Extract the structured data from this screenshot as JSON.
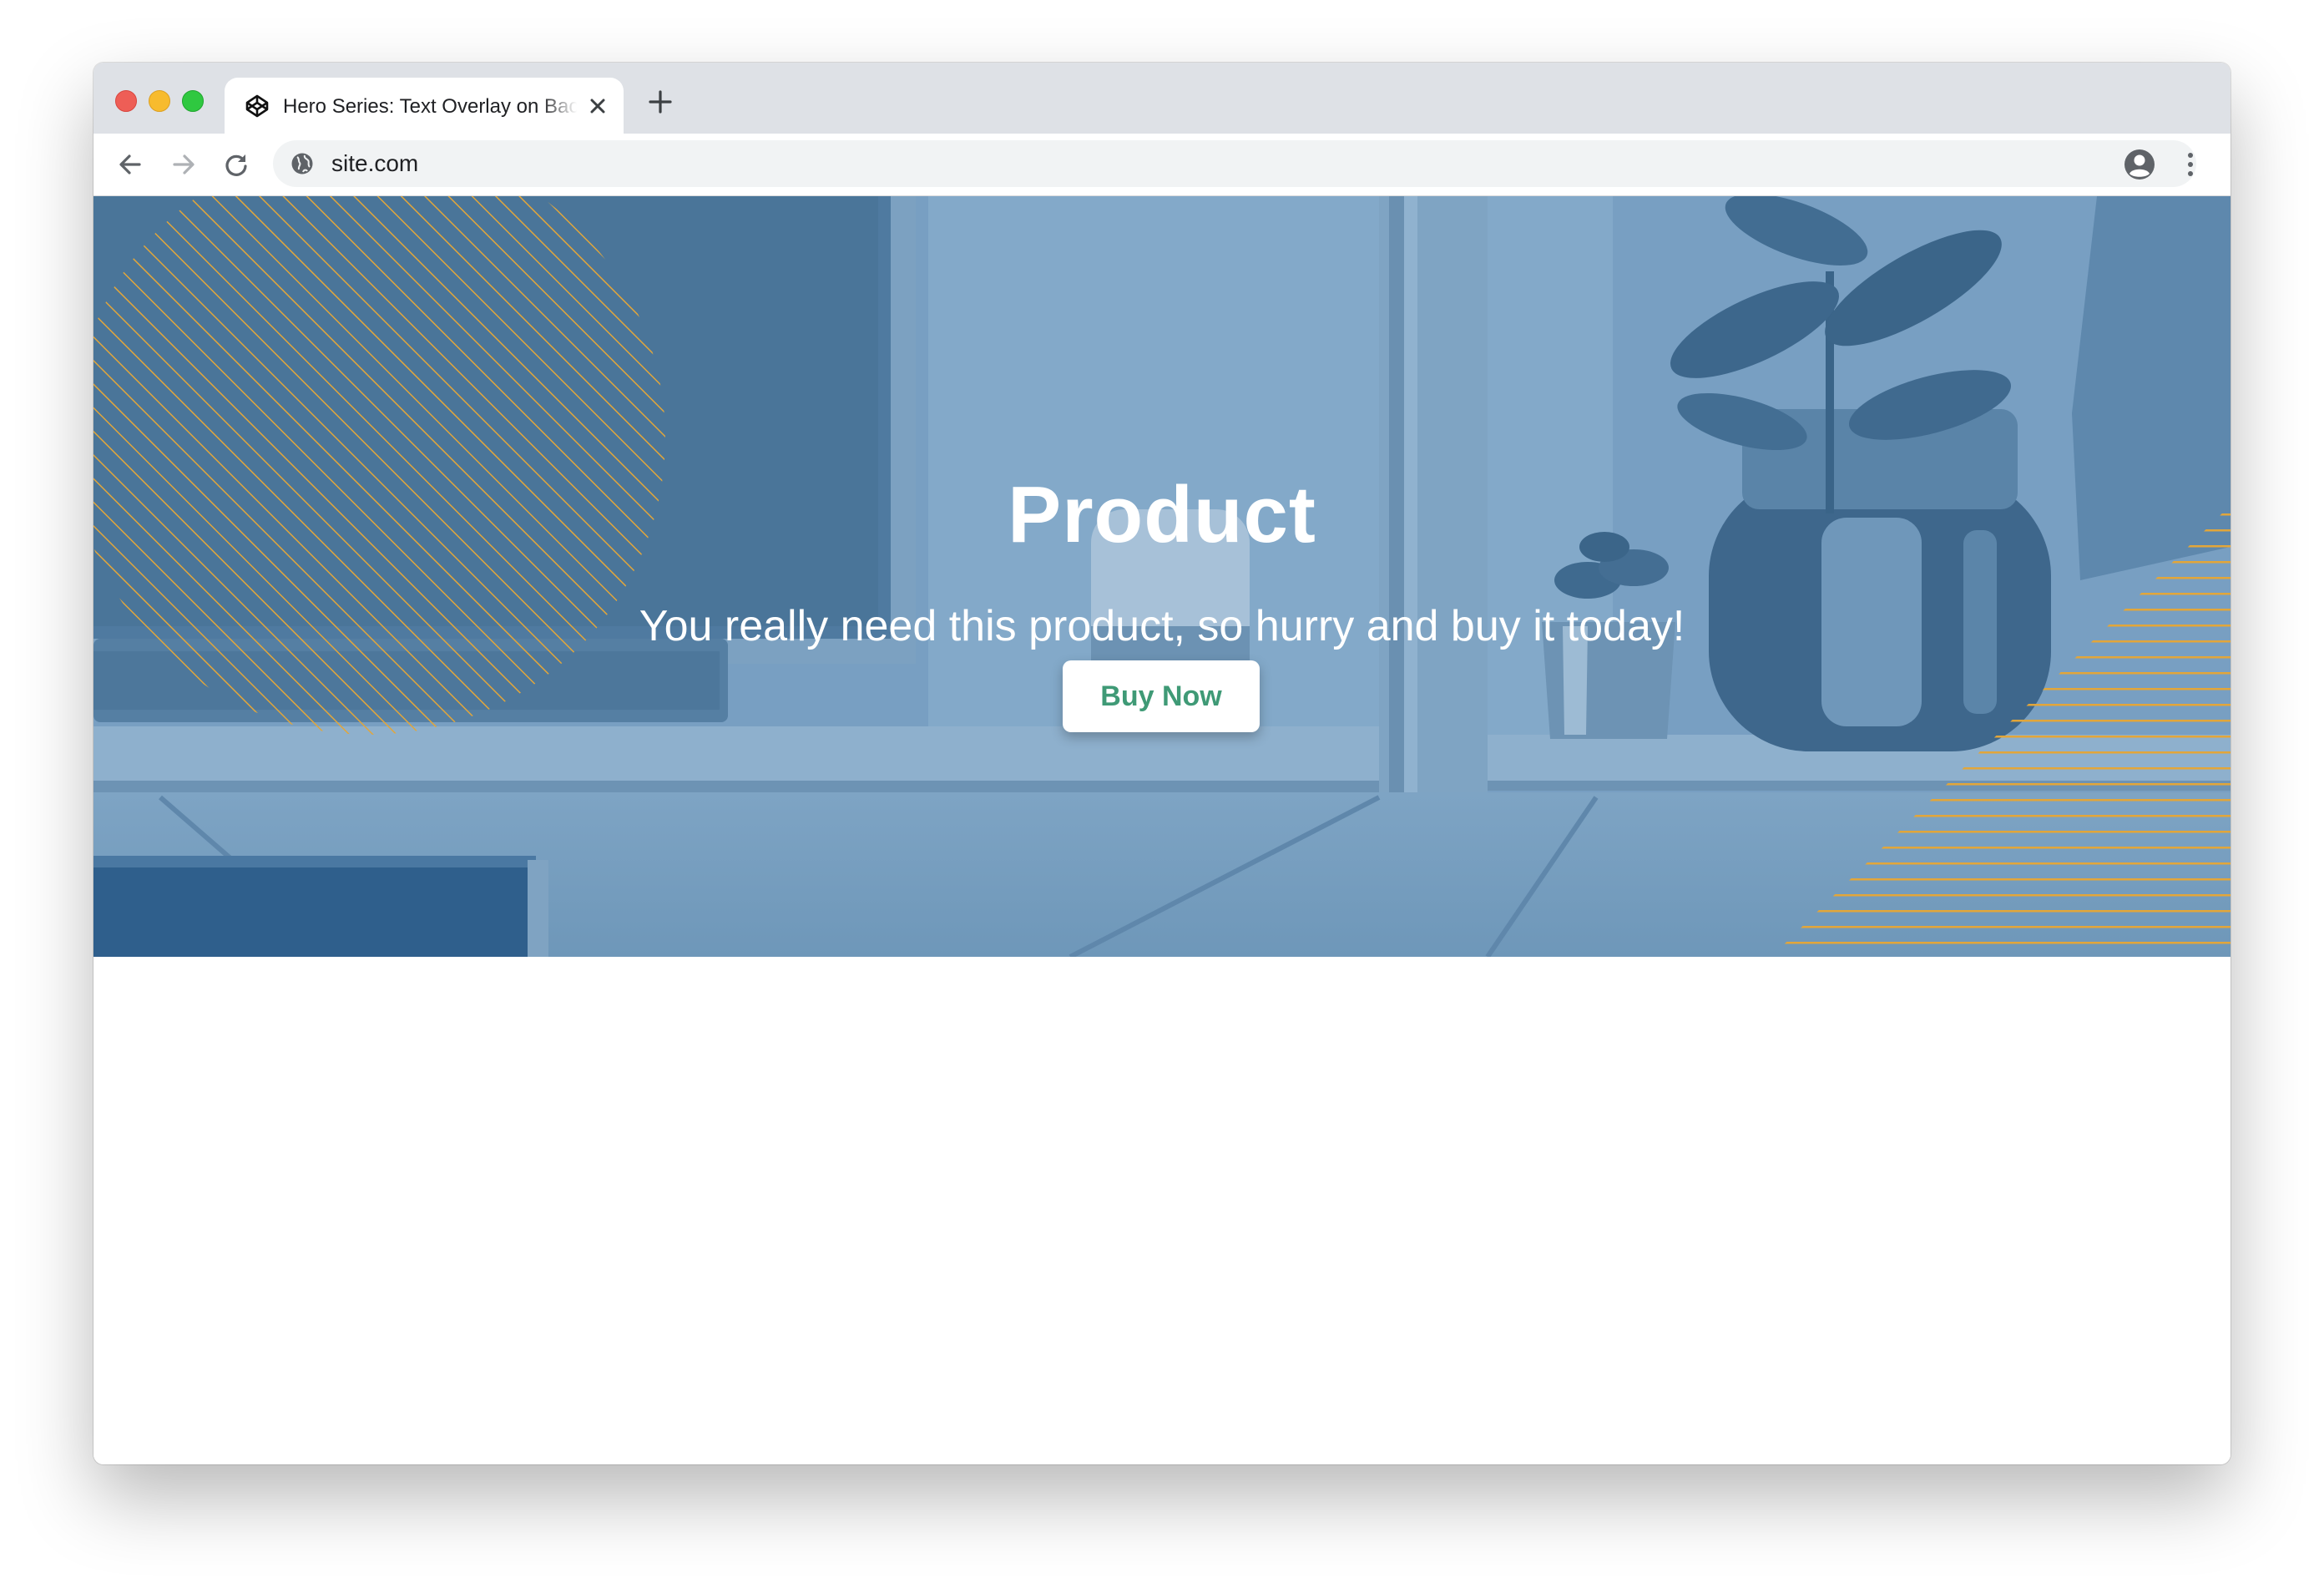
{
  "browser": {
    "tab": {
      "title": "Hero Series: Text Overlay on Background Image",
      "favicon": "codepen-icon"
    },
    "address_bar": {
      "url": "site.com",
      "site_icon": "globe-icon"
    },
    "toolbar_icons": [
      "back-arrow-icon",
      "forward-arrow-icon",
      "reload-icon",
      "profile-icon",
      "kebab-menu-icon"
    ]
  },
  "hero": {
    "title": "Product",
    "subtitle": "You really need this product, so hurry and buy it today!",
    "button_label": "Buy Now",
    "colors": {
      "overlay": "#6f9bc0",
      "stripe_accent": "#e2a63a",
      "button_text": "#3f9a76"
    }
  }
}
